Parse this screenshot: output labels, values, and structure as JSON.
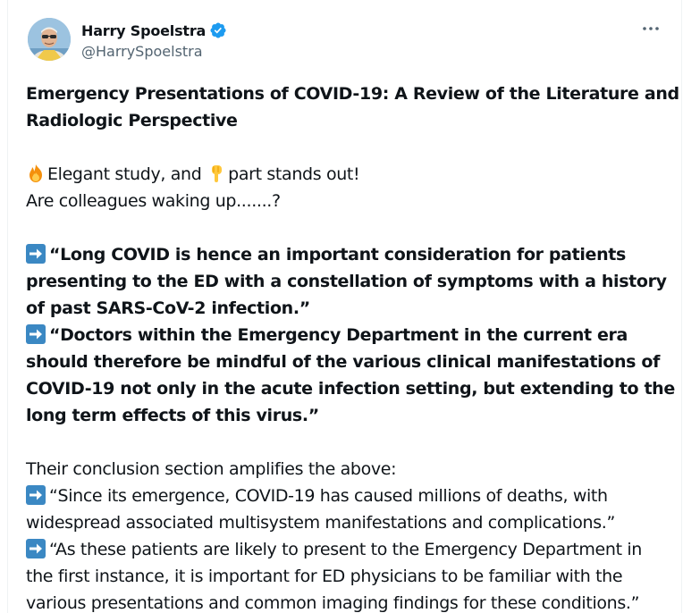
{
  "author": {
    "display_name": "Harry Spoelstra",
    "handle": "@HarrySpoelstra",
    "verified": true
  },
  "icons": {
    "verified": "verified-badge-icon",
    "more": "more-options-icon",
    "fire": "fire-emoji",
    "pointing_down": "backhand-index-pointing-down-emoji",
    "right_arrow": "right-arrow-emoji"
  },
  "colors": {
    "verified_badge": "#1d9bf0",
    "arrow_emoji_bg": "#3b88c3",
    "handle": "#536471",
    "text": "#0f1419"
  },
  "tweet": {
    "title_line_1": "Emergency Presentations of COVID-19: A Review of the Literature and",
    "title_line_2": "Radiologic Perspective",
    "intro_part_1": "Elegant study, and ",
    "intro_part_2": "part stands out!",
    "intro_line_2": "Are colleagues waking up.......?",
    "quote1_line_1": "“Long COVID is hence an important consideration for patients",
    "quote1_line_2": "presenting to the ED with a constellation of symptoms with a history",
    "quote1_line_3": "of past SARS-CoV-2 infection.”",
    "quote2_line_1": "“Doctors within the Emergency Department in the current era",
    "quote2_line_2": "should therefore be mindful of the various clinical manifestations of",
    "quote2_line_3": "COVID-19 not only in the acute infection setting, but extending to the",
    "quote2_line_4": "long term effects of this virus.”",
    "conclusion_intro": "Their conclusion section amplifies the above:",
    "quote3_line_1": "“Since its emergence, COVID-19 has caused millions of deaths, with",
    "quote3_line_2": "widespread associated multisystem manifestations and complications.”",
    "quote4_line_1": "“As these patients are likely to present to the Emergency Department in",
    "quote4_line_2": "the first instance, it is important for ED physicians to be familiar with the",
    "quote4_line_3": "various presentations and common imaging findings for these conditions.”"
  }
}
